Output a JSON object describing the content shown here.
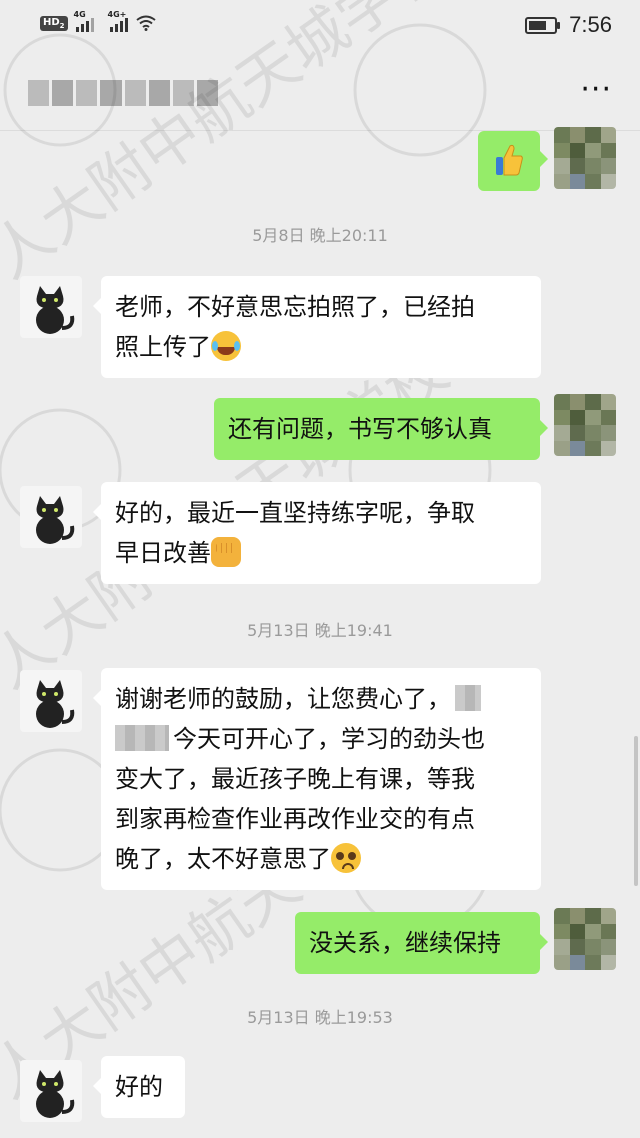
{
  "status_bar": {
    "network_badge": "HD",
    "network_badge_sub": "2",
    "signal_1_label": "4G",
    "signal_2_label": "4G+",
    "time": "7:56",
    "icons": [
      "signal-icon",
      "wifi-icon",
      "battery-icon"
    ]
  },
  "header": {
    "title": "",
    "more_label": "···"
  },
  "messages": [
    {
      "type": "out",
      "kind": "emoji",
      "content": "thumbs-up"
    },
    {
      "type": "time",
      "text": "5月8日 晚上20:11"
    },
    {
      "type": "in",
      "line1": "老师，不好意思忘拍照了，已经拍",
      "line2": "照上传了",
      "emoji": "laugh-cry"
    },
    {
      "type": "out",
      "text": "还有问题，书写不够认真"
    },
    {
      "type": "in",
      "line1": "好的，最近一直坚持练字呢，争取",
      "line2": "早日改善",
      "emoji": "fist"
    },
    {
      "type": "time",
      "text": "5月13日 晚上19:41"
    },
    {
      "type": "in",
      "line1": "谢谢老师的鼓励，让您费心了，",
      "line2": "今天可开心了，学习的劲头也",
      "line3": "变大了，最近孩子晚上有课，等我",
      "line4": "到家再检查作业再改作业交的有点",
      "line5": "晚了，太不好意思了",
      "emoji": "pleading"
    },
    {
      "type": "out",
      "text": "没关系，继续保持"
    },
    {
      "type": "time",
      "text": "5月13日 晚上19:53"
    },
    {
      "type": "in",
      "text": "好的"
    }
  ],
  "colors": {
    "background": "#ededed",
    "bubble_out": "#95ec69",
    "bubble_in": "#ffffff",
    "timestamp": "#9a9a9a"
  },
  "watermark_text": "人大附中航天城学校 THE AEROSPACE CITY SCHOOL OF RDFZ"
}
